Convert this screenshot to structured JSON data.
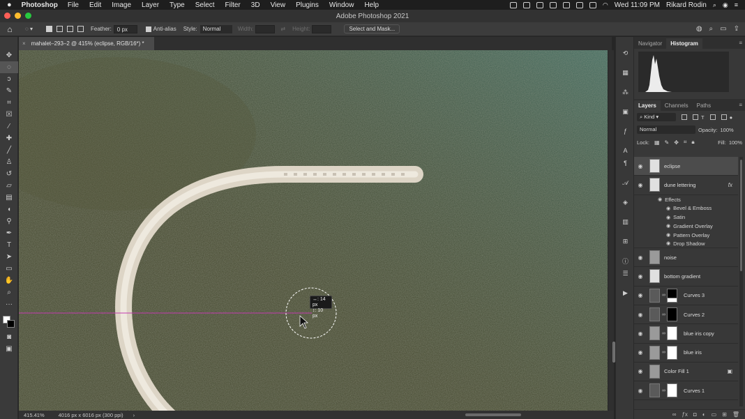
{
  "menubar": {
    "app": "Photoshop",
    "items": [
      "File",
      "Edit",
      "Image",
      "Layer",
      "Type",
      "Select",
      "Filter",
      "3D",
      "View",
      "Plugins",
      "Window",
      "Help"
    ],
    "clock": "Wed 11:09 PM",
    "user": "Rikard Rodin"
  },
  "window": {
    "title": "Adobe Photoshop 2021",
    "lights": {
      "close": "#fe5f57",
      "minimize": "#febc2e",
      "zoom": "#28c840"
    }
  },
  "options": {
    "feather_label": "Feather:",
    "feather_value": "0 px",
    "antialias_label": "Anti-alias",
    "style_label": "Style:",
    "style_value": "Normal",
    "width_label": "Width:",
    "height_label": "Height:",
    "select_mask_label": "Select and Mask..."
  },
  "document": {
    "tab_title": "mahalet–293–2 @ 415% (eclipse, RGB/16*) *",
    "zoom": "415.41%",
    "doc_info": "4016 px x 6016 px (300 ppi)"
  },
  "canvas": {
    "measure_w": "↔: 14 px",
    "measure_h": "↕: 10 px",
    "guide_color": "#c43bb0"
  },
  "tools": [
    "move-tool",
    "elliptical-marquee-tool",
    "lasso-tool",
    "quick-selection-tool",
    "crop-tool",
    "frame-tool",
    "eyedropper-tool",
    "spot-healing-tool",
    "brush-tool",
    "clone-stamp-tool",
    "history-brush-tool",
    "eraser-tool",
    "gradient-tool",
    "blur-tool",
    "dodge-tool",
    "pen-tool",
    "type-tool",
    "path-selection-tool",
    "rectangle-tool",
    "hand-tool",
    "zoom-tool",
    "more-tools"
  ],
  "panels": {
    "top_tabs": [
      "Navigator",
      "Histogram"
    ],
    "layers_tabs": [
      "Layers",
      "Channels",
      "Paths"
    ],
    "kind_label": "Kind",
    "blend_mode": "Normal",
    "opacity_label": "Opacity:",
    "opacity_value": "100%",
    "lock_label": "Lock:",
    "fill_label": "Fill:",
    "fill_value": "100%"
  },
  "layers": [
    {
      "name": "eclipse",
      "type": "pixel",
      "selected": true
    },
    {
      "name": "dune lettering",
      "type": "pixel",
      "fx": "fx"
    },
    {
      "name": "noise",
      "type": "pixel"
    },
    {
      "name": "bottom gradient",
      "type": "pixel"
    },
    {
      "name": "Curves 3",
      "type": "curves"
    },
    {
      "name": "Curves 2",
      "type": "curves"
    },
    {
      "name": "blue iris copy",
      "type": "masked"
    },
    {
      "name": "blue iris",
      "type": "masked"
    },
    {
      "name": "Color Fill 1",
      "type": "fill"
    },
    {
      "name": "Curves 1",
      "type": "curves"
    }
  ],
  "effects": {
    "heading": "Effects",
    "items": [
      "Bevel & Emboss",
      "Satin",
      "Gradient Overlay",
      "Pattern Overlay",
      "Drop Shadow"
    ]
  }
}
